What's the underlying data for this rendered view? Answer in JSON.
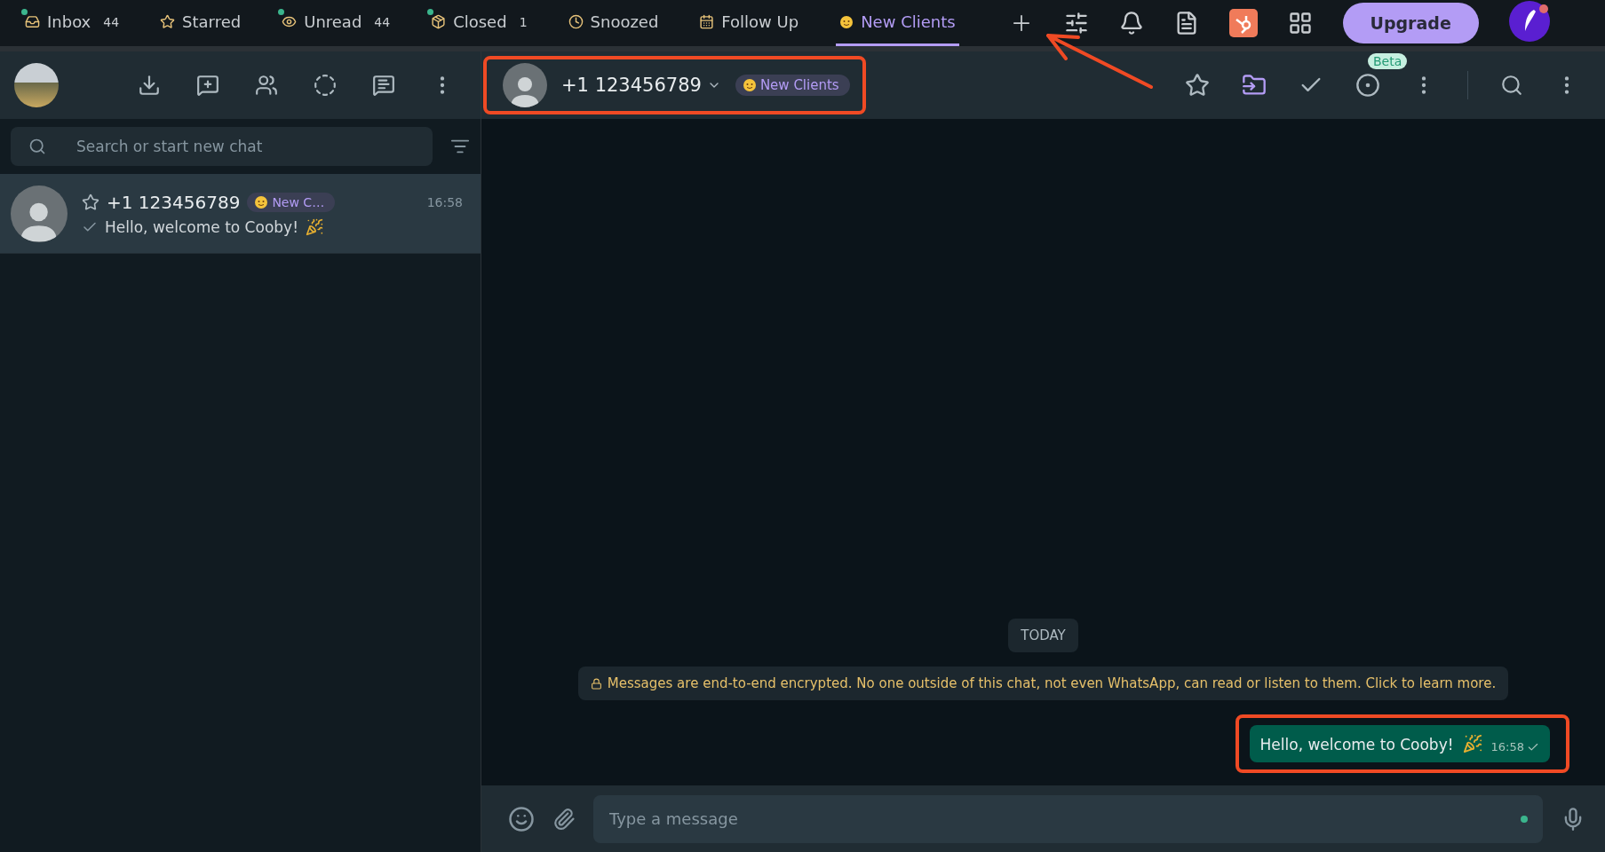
{
  "top_tabs": [
    {
      "label": "Inbox",
      "count": "44",
      "dot": true,
      "selected": false
    },
    {
      "label": "Starred",
      "dot": false,
      "selected": false
    },
    {
      "label": "Unread",
      "count": "44",
      "dot": true,
      "selected": false
    },
    {
      "label": "Closed",
      "count": "1",
      "dot": true,
      "selected": false
    },
    {
      "label": "Snoozed",
      "dot": false,
      "selected": false
    },
    {
      "label": "Follow Up",
      "dot": false,
      "selected": false
    },
    {
      "label": "New Clients",
      "dot": false,
      "selected": true
    }
  ],
  "upgrade_button": "Upgrade",
  "sidebar": {
    "search": {
      "placeholder": "Search or start new chat"
    },
    "chats": [
      {
        "name": "+1 123456789",
        "tag": "New C…",
        "time": "16:58",
        "preview": "Hello, welcome to Cooby!",
        "selected": true
      }
    ]
  },
  "chat": {
    "contact": "+1 123456789",
    "tag": "New Clients",
    "beta_badge": "Beta",
    "date_divider": "TODAY",
    "encryption_notice": "Messages are end-to-end encrypted. No one outside of this chat, not even WhatsApp, can read or listen to them. Click to learn more.",
    "messages": [
      {
        "text": "Hello, welcome to Cooby!",
        "time": "16:58",
        "outgoing": true
      }
    ],
    "compose": {
      "placeholder": "Type a message"
    }
  }
}
